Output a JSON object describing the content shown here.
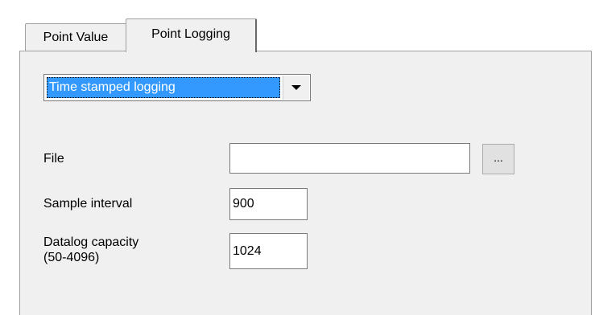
{
  "tabs": [
    {
      "label": "Point Value",
      "active": false
    },
    {
      "label": "Point Logging",
      "active": true
    }
  ],
  "logging_mode": {
    "selected": "Time stamped logging"
  },
  "file": {
    "label": "File",
    "value": "",
    "browse_label": "..."
  },
  "sample_interval": {
    "label": "Sample interval",
    "value": "900"
  },
  "datalog_capacity": {
    "label_line1": "Datalog capacity",
    "label_line2": "(50-4096)",
    "value": "1024"
  },
  "icons": {
    "dropdown": "chevron-down-icon"
  }
}
